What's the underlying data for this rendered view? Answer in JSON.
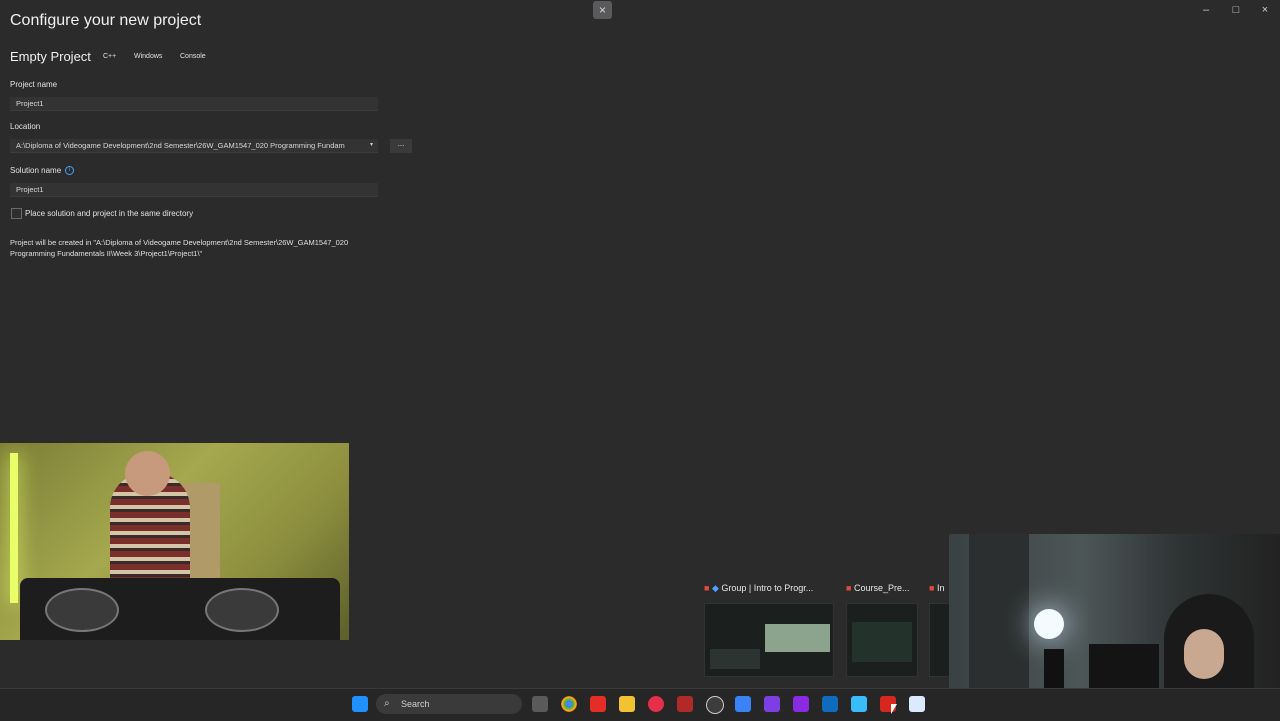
{
  "window": {
    "close_dialog_glyph": "×",
    "controls": [
      "–",
      "□",
      "×"
    ]
  },
  "page": {
    "title": "Configure your new project",
    "template_name": "Empty Project",
    "tags": [
      "C++",
      "Windows",
      "Console"
    ]
  },
  "form": {
    "project_name_label": "Project name",
    "project_name_value": "Project1",
    "location_label": "Location",
    "location_value": "A:\\Diploma of Videogame Development\\2nd Semester\\26W_GAM1547_020 Programming Fundam",
    "browse_label": "...",
    "solution_name_label": "Solution name",
    "solution_name_value": "Project1",
    "same_dir_label": "Place solution and project in the same directory",
    "same_dir_checked": false,
    "info_glyph": "i",
    "created_note": "Project will be created in \"A:\\Diploma of Videogame Development\\2nd Semester\\26W_GAM1547_020 Programming Fundamentals II\\Week 3\\Project1\\Project1\\\""
  },
  "preview": {
    "tabs": [
      "Group | Intro to Progr...",
      "Course_Pre...",
      "In"
    ]
  },
  "taskbar": {
    "search_placeholder": "Search",
    "icons": [
      "windows-start-icon",
      "search-icon",
      "task-view-icon",
      "chrome-icon",
      "youtube-icon",
      "file-explorer-icon",
      "music-icon",
      "news-icon",
      "obs-icon",
      "vs-code-icon",
      "visual-studio-icon",
      "visual-studio-purple-icon",
      "outlook-icon",
      "notepad-icon",
      "acrobat-icon",
      "remote-desktop-icon"
    ]
  },
  "colors": {
    "background": "#2b2b2c",
    "accent": "#4aa3ff"
  }
}
